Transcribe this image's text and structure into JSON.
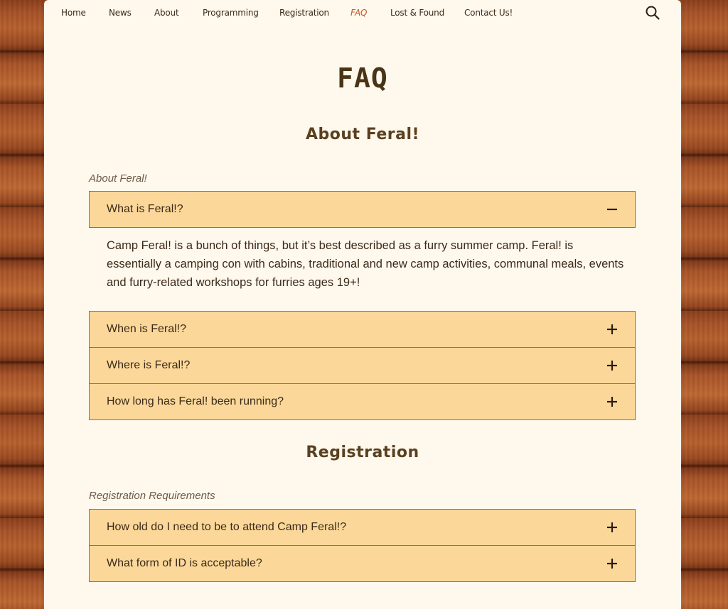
{
  "nav": {
    "items": [
      {
        "label": "Home",
        "active": false
      },
      {
        "label": "News",
        "active": false
      },
      {
        "label": "About",
        "active": false
      },
      {
        "label": "Programming",
        "active": false
      },
      {
        "label": "Registration",
        "active": false
      },
      {
        "label": "FAQ",
        "active": true
      },
      {
        "label": "Lost & Found",
        "active": false
      },
      {
        "label": "Contact Us!",
        "active": false
      }
    ],
    "search_icon": "search-icon"
  },
  "page_title": "FAQ",
  "sections": [
    {
      "title": "About Feral!",
      "group_label": "About Feral!",
      "items": [
        {
          "question": "What is Feral!?",
          "expanded": true,
          "answer": "Camp Feral! is a bunch of things, but it’s best described as a furry summer camp. Feral! is essentially a camping con with cabins, traditional and new camp activities, communal meals, events and furry-related workshops for furries ages 19+!"
        },
        {
          "question": "When is Feral!?",
          "expanded": false
        },
        {
          "question": "Where is Feral!?",
          "expanded": false
        },
        {
          "question": "How long has Feral! been running?",
          "expanded": false
        }
      ]
    },
    {
      "title": "Registration",
      "group_label": "Registration Requirements",
      "items": [
        {
          "question": "How old do I need to be to attend Camp Feral!?",
          "expanded": false
        },
        {
          "question": "What form of ID is acceptable?",
          "expanded": false
        }
      ]
    }
  ],
  "colors": {
    "page_bg": "#fff8ec",
    "accordion_bg": "#fbd89a",
    "active_nav": "#c0562a",
    "text": "#3b2a1a"
  }
}
